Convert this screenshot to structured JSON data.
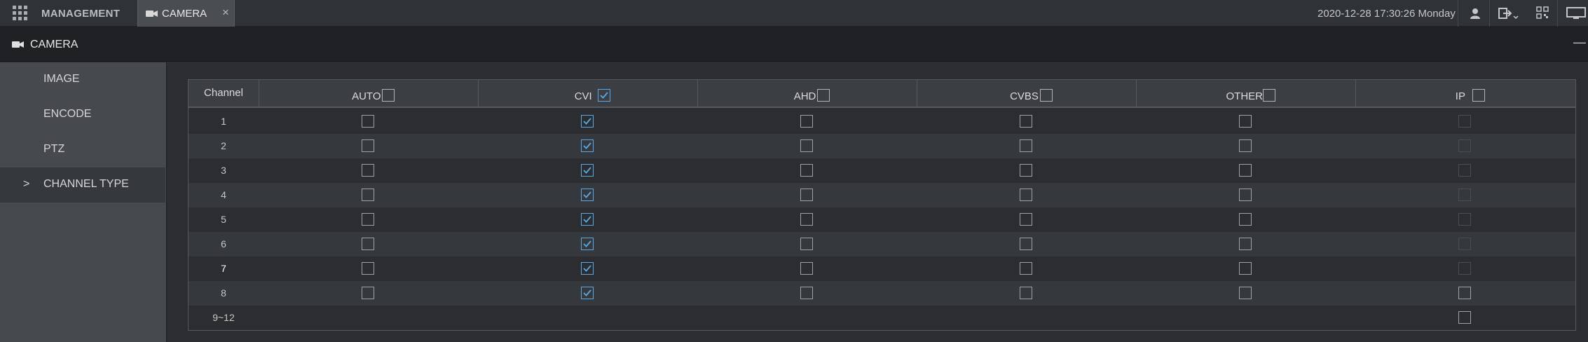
{
  "topbar": {
    "grid_icon": "grid-menu-icon",
    "management_label": "MANAGEMENT",
    "active_tab": {
      "label": "CAMERA",
      "icon": "camera-icon",
      "close": "×"
    },
    "datetime": "2020-12-28 17:30:26 Monday",
    "icons": [
      "user-icon",
      "logout-icon",
      "qr-code-icon",
      "display-icon"
    ]
  },
  "titlebar": {
    "title": "CAMERA",
    "icon": "camera-icon",
    "minimize": "—"
  },
  "sidebar": {
    "items": [
      {
        "label": "IMAGE",
        "active": false
      },
      {
        "label": "ENCODE",
        "active": false
      },
      {
        "label": "PTZ",
        "active": false
      },
      {
        "label": "CHANNEL TYPE",
        "active": true,
        "marker": ">"
      }
    ]
  },
  "table": {
    "headers": [
      {
        "key": "channel",
        "label": "Channel"
      },
      {
        "key": "auto",
        "label": "AUTO",
        "checked": false
      },
      {
        "key": "cvi",
        "label": "CVI",
        "checked": true
      },
      {
        "key": "ahd",
        "label": "AHD",
        "checked": false
      },
      {
        "key": "cvbs",
        "label": "CVBS",
        "checked": false
      },
      {
        "key": "other",
        "label": "OTHER",
        "checked": false
      },
      {
        "key": "ip",
        "label": "IP",
        "checked": false
      }
    ],
    "rows": [
      {
        "channel": "1",
        "auto": "unchecked",
        "cvi": "checked",
        "ahd": "unchecked",
        "cvbs": "unchecked",
        "other": "unchecked",
        "ip": "disabled"
      },
      {
        "channel": "2",
        "auto": "unchecked",
        "cvi": "checked",
        "ahd": "unchecked",
        "cvbs": "unchecked",
        "other": "unchecked",
        "ip": "disabled"
      },
      {
        "channel": "3",
        "auto": "unchecked",
        "cvi": "checked",
        "ahd": "unchecked",
        "cvbs": "unchecked",
        "other": "unchecked",
        "ip": "disabled"
      },
      {
        "channel": "4",
        "auto": "unchecked",
        "cvi": "checked",
        "ahd": "unchecked",
        "cvbs": "unchecked",
        "other": "unchecked",
        "ip": "disabled"
      },
      {
        "channel": "5",
        "auto": "unchecked",
        "cvi": "checked",
        "ahd": "unchecked",
        "cvbs": "unchecked",
        "other": "unchecked",
        "ip": "disabled"
      },
      {
        "channel": "6",
        "auto": "unchecked",
        "cvi": "checked",
        "ahd": "unchecked",
        "cvbs": "unchecked",
        "other": "unchecked",
        "ip": "disabled"
      },
      {
        "channel": "7",
        "auto": "unchecked",
        "cvi": "checked",
        "ahd": "unchecked",
        "cvbs": "unchecked",
        "other": "unchecked",
        "ip": "disabled"
      },
      {
        "channel": "8",
        "auto": "unchecked",
        "cvi": "checked",
        "ahd": "unchecked",
        "cvbs": "unchecked",
        "other": "unchecked",
        "ip": "unchecked"
      },
      {
        "channel": "9~12",
        "auto": "none",
        "cvi": "none",
        "ahd": "none",
        "cvbs": "none",
        "other": "none",
        "ip": "unchecked"
      }
    ]
  },
  "colors": {
    "accent": "#5aa9e6",
    "panel": "#2b2d30",
    "sidebar": "#46494d",
    "titlebar": "#1f2124"
  }
}
